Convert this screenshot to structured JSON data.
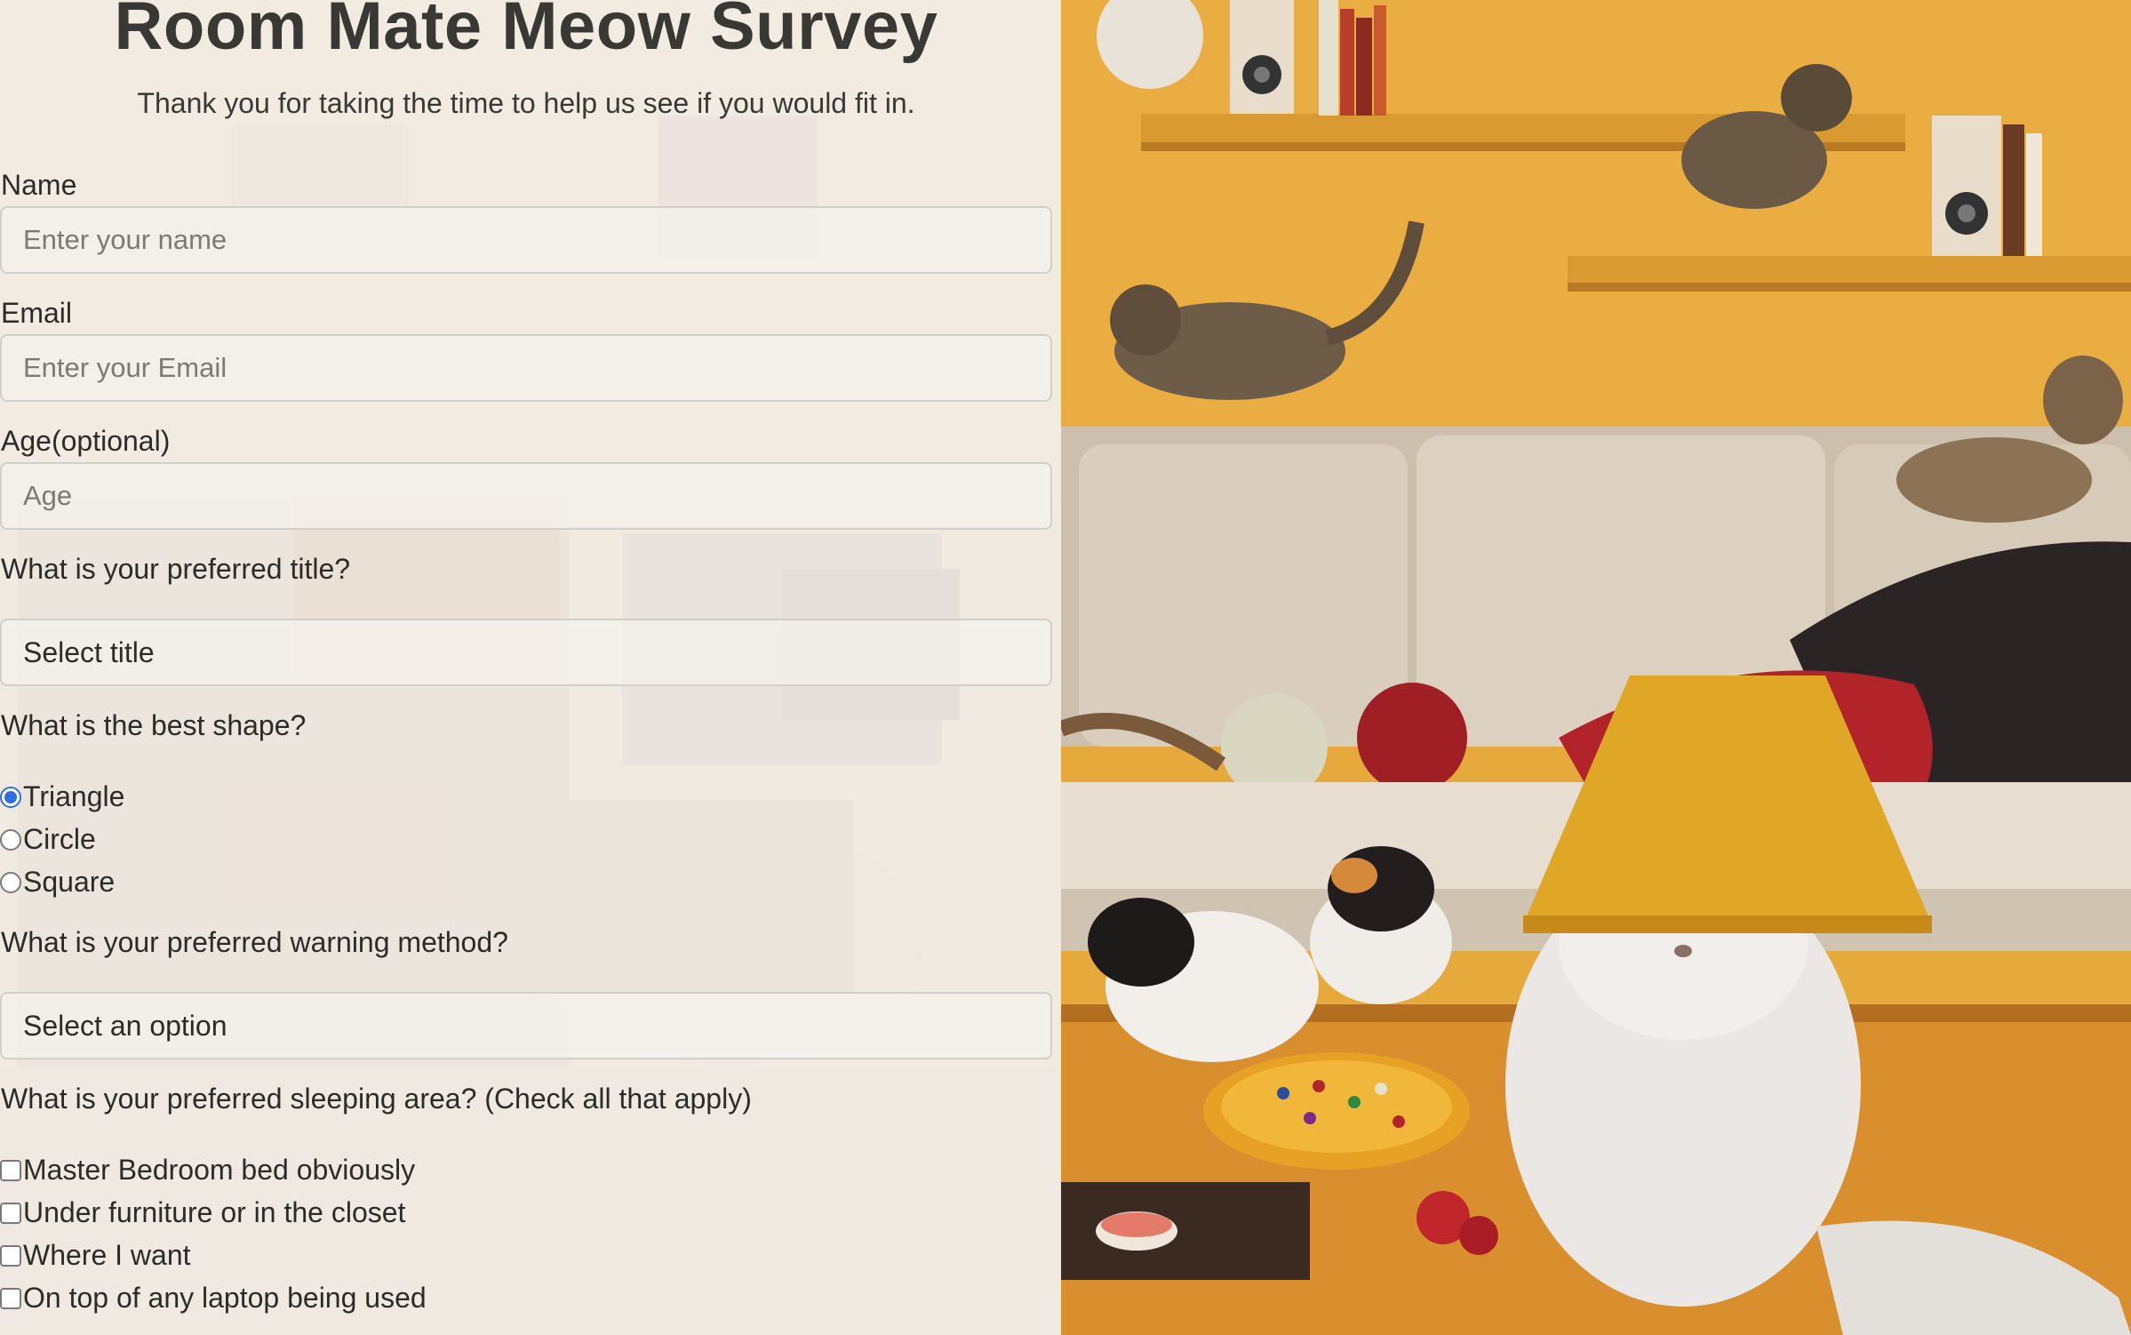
{
  "survey": {
    "title": "Room Mate Meow Survey",
    "subtitle": "Thank you for taking the time to help us see if you would fit in.",
    "name": {
      "label": "Name",
      "placeholder": "Enter your name"
    },
    "email": {
      "label": "Email",
      "placeholder": "Enter your Email"
    },
    "age": {
      "label": "Age(optional)",
      "placeholder": "Age"
    },
    "title_question": {
      "label": "What is your preferred title?",
      "selected": "Select title"
    },
    "shape_question": {
      "label": "What is the best shape?",
      "options": [
        "Triangle",
        "Circle",
        "Square"
      ],
      "checked": "Triangle"
    },
    "warning_question": {
      "label": "What is your preferred warning method?",
      "selected": "Select an option"
    },
    "sleeping_question": {
      "label": "What is your preferred sleeping area? (Check all that apply)",
      "options": [
        "Master Bedroom bed obviously",
        "Under furniture or in the closet",
        "Where I want",
        "On top of any laptop being used"
      ]
    }
  },
  "colors": {
    "radio_checked": "#2f6fe0",
    "wall": "#e6a93c",
    "couch": "#d9cdbd",
    "lampshade": "#e0a626",
    "pillow": "#b3232a"
  },
  "images": {
    "background_left": "faded-cats-living-room-photo",
    "right_panel": "cats-in-living-room-photo"
  }
}
